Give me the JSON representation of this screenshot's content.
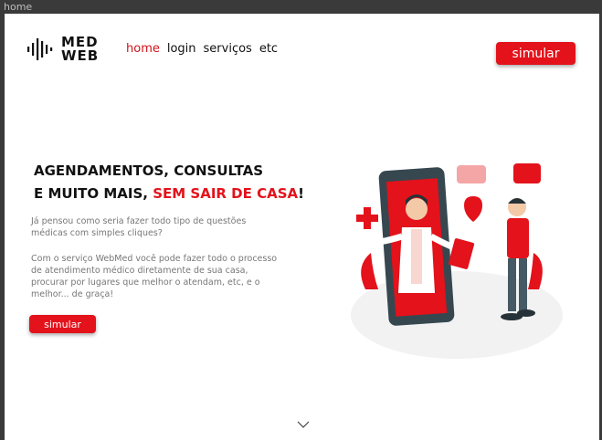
{
  "window": {
    "title": "home"
  },
  "logo": {
    "line1": "MED",
    "line2": "WEB"
  },
  "nav": {
    "items": [
      "home",
      "login",
      "serviços",
      "etc"
    ]
  },
  "header": {
    "cta_label": "simular"
  },
  "hero": {
    "headline_line1": "AGENDAMENTOS, CONSULTAS",
    "headline_line2": "E MUITO MAIS,",
    "headline_highlight": "SEM SAIR DE CASA",
    "headline_end": "!",
    "paragraph1": "Já pensou como seria fazer todo tipo de questões médicas com simples cliques?",
    "paragraph2": "Com o serviço WebMed você pode fazer todo o processo de atendimento médico diretamente de sua casa, procurar por lugares que melhor o atendam, etc, e o melhor... de graça!",
    "cta_label": "simular"
  },
  "colors": {
    "accent": "#e3121b",
    "text": "#111111",
    "muted": "#777777"
  }
}
